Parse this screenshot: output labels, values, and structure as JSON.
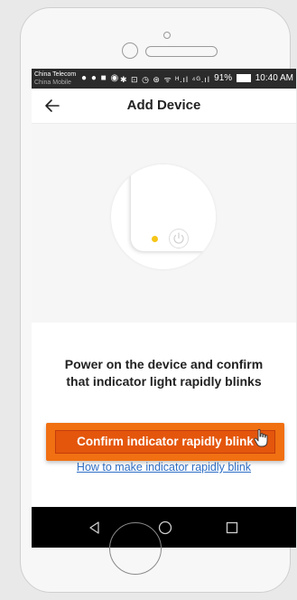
{
  "status_bar": {
    "carrier_primary": "China Telecom",
    "carrier_secondary": "China Mobile",
    "left_icons": "● ● ■ ◉",
    "right_icons": "✱ ⊡ ◷ ⊛ ᯤ ᴴ.ıl ⁴ᴳ.ıl",
    "battery_percent": "91%",
    "time": "10:40 AM"
  },
  "header": {
    "title": "Add Device",
    "back_icon": "arrow-left"
  },
  "illustration": {
    "indicator_color": "#f5c518",
    "power_icon": "power"
  },
  "main": {
    "instruction_line1": "Power on the device and confirm",
    "instruction_line2": "that indicator light rapidly blinks",
    "help_link": "How to make indicator rapidly blink",
    "confirm_button_label": "Confirm indicator rapidly blink"
  },
  "colors": {
    "accent": "#f07012",
    "link": "#2f6fc6",
    "indicator": "#f5c518"
  },
  "nav_bar": {
    "back": "triangle-back",
    "home": "circle-home",
    "recents": "square-recents"
  }
}
